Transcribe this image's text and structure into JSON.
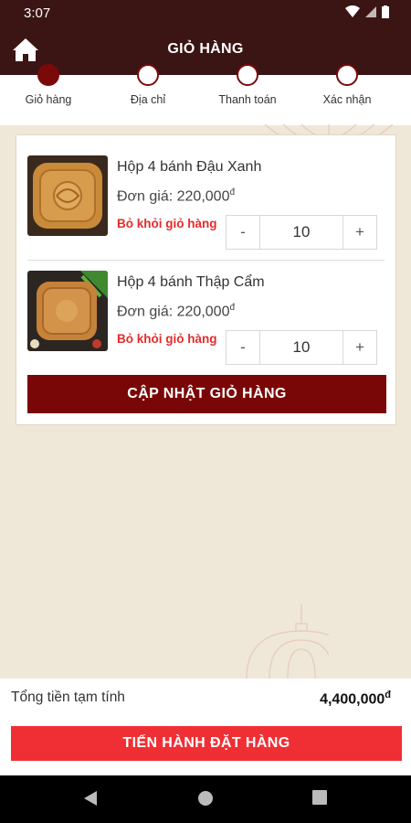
{
  "status_bar": {
    "time": "3:07"
  },
  "app_bar": {
    "title": "GIỎ HÀNG"
  },
  "steps": [
    {
      "label": "Giỏ hàng",
      "active": true
    },
    {
      "label": "Địa chỉ",
      "active": false
    },
    {
      "label": "Thanh toán",
      "active": false
    },
    {
      "label": "Xác nhận",
      "active": false
    }
  ],
  "cart": {
    "items": [
      {
        "name": "Hộp 4 bánh Đậu Xanh",
        "price_label": "Đơn giá: 220,000",
        "currency": "đ",
        "remove_label": "Bỏ khỏi giỏ hàng",
        "quantity": "10"
      },
      {
        "name": "Hộp 4 bánh Thập Cẩm",
        "price_label": "Đơn giá: 220,000",
        "currency": "đ",
        "remove_label": "Bỏ khỏi giỏ hàng",
        "quantity": "10"
      }
    ],
    "minus": "-",
    "plus": "+",
    "update_label": "CẬP NHẬT GIỎ HÀNG"
  },
  "summary": {
    "subtotal_label": "Tổng tiền tạm tính",
    "subtotal_value": "4,400,000",
    "currency": "đ",
    "checkout_label": "TIẾN HÀNH ĐẶT HÀNG"
  },
  "colors": {
    "header": "#3b1414",
    "accent": "#7a0707",
    "checkout": "#f02f35",
    "remove": "#e52a2a"
  }
}
